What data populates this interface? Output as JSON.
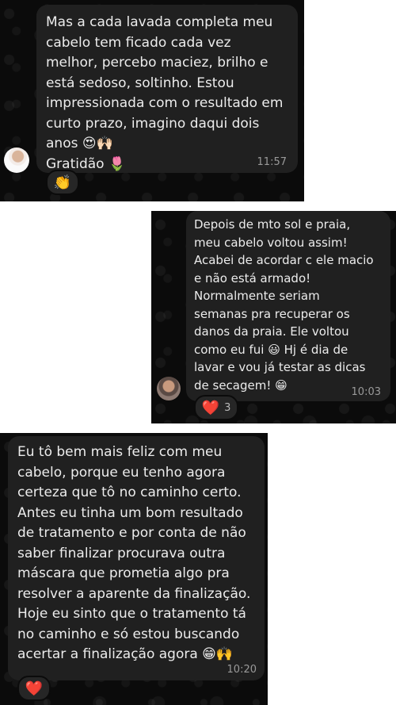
{
  "messages": [
    {
      "text": "Mas a cada lavada completa meu\ncabelo tem ficado cada vez\nmelhor, percebo maciez, brilho e\nestá sedoso, soltinho. Estou\nimpressionada com o resultado em\ncurto prazo, imagino daqui dois\nanos 😍🙌🏻\nGratidão 🌷",
      "time": "11:57",
      "reaction": {
        "emoji": "👏",
        "count": ""
      }
    },
    {
      "text": "Depois de mto sol e praia,\nmeu cabelo voltou assim!\nAcabei de acordar c ele macio\ne não está armado!\nNormalmente seriam\nsemanas pra recuperar os\ndanos da praia. Ele voltou\ncomo eu fui 😃 Hj é dia de\nlavar e vou já testar as dicas\nde secagem! 😁",
      "time": "10:03",
      "reaction": {
        "emoji": "❤️",
        "count": "3"
      }
    },
    {
      "text": "Eu tô bem mais feliz com meu\ncabelo, porque eu tenho agora\ncerteza que tô no caminho certo.\nAntes eu tinha um bom resultado\nde tratamento e por conta de não\nsaber finalizar procurava outra\nmáscara que prometia algo pra\nresolver a aparente da finalização.\nHoje eu sinto que o tratamento tá\nno caminho e só estou buscando\nacertar a finalização agora 😁🙌",
      "time": "10:20",
      "reaction": {
        "emoji": "❤️",
        "count": ""
      }
    }
  ],
  "colors": {
    "chat_background": "#0b0b0b",
    "bubble": "#202020",
    "text": "#ececec",
    "time": "#9a9a9a"
  }
}
